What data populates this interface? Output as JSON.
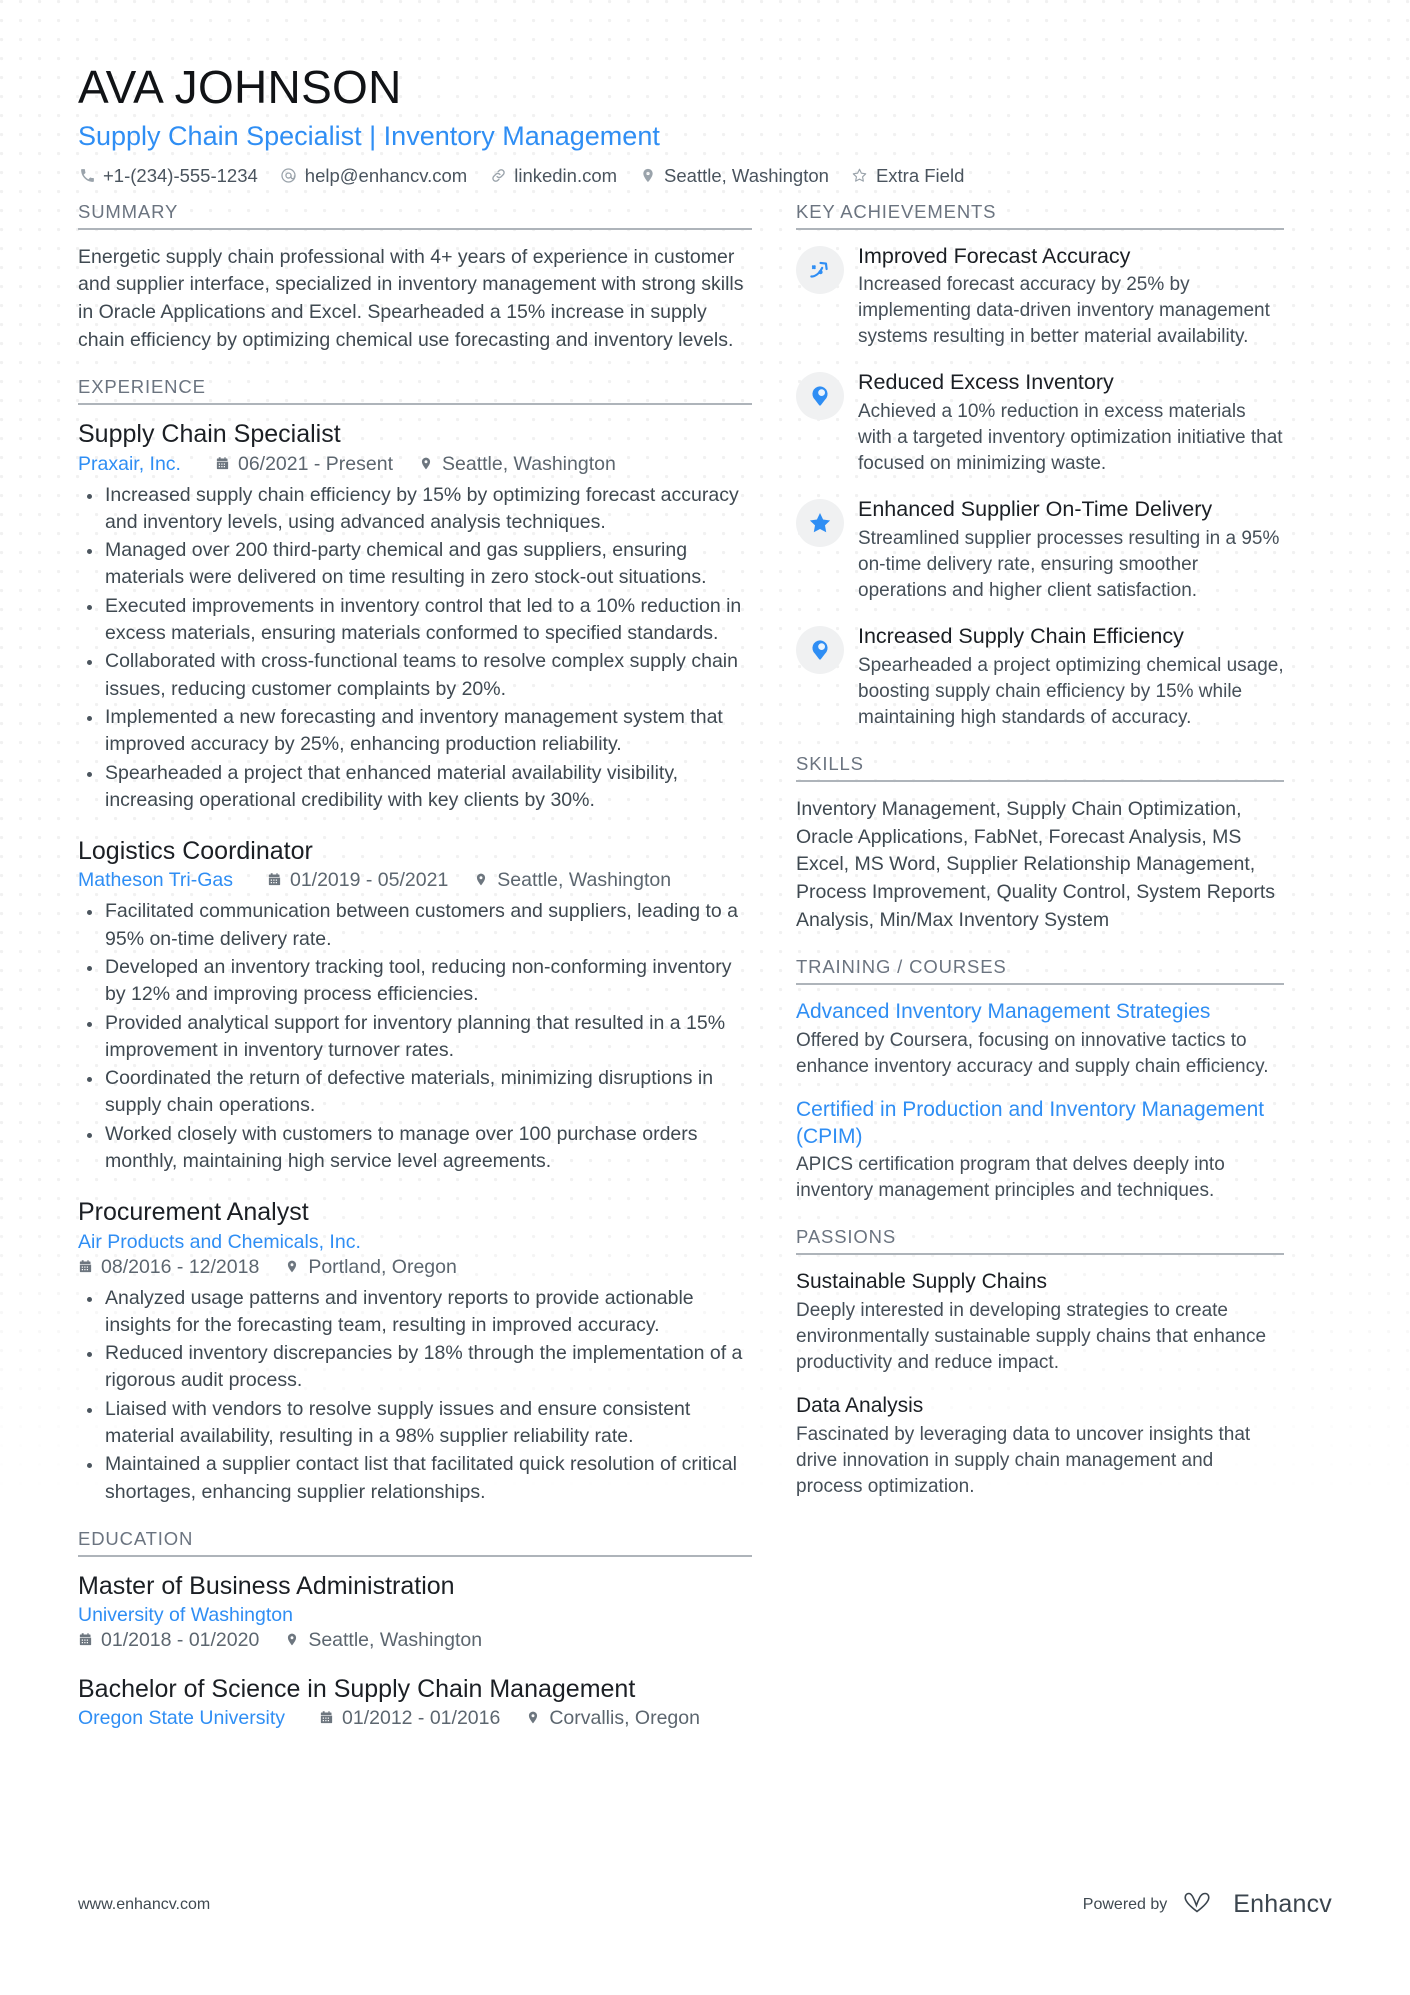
{
  "header": {
    "name": "AVA JOHNSON",
    "headline": "Supply Chain Specialist | Inventory Management",
    "contacts": [
      {
        "icon": "phone-icon",
        "text": "+1-(234)-555-1234"
      },
      {
        "icon": "email-icon",
        "text": "help@enhancv.com"
      },
      {
        "icon": "link-icon",
        "text": "linkedin.com"
      },
      {
        "icon": "location-icon",
        "text": "Seattle, Washington"
      },
      {
        "icon": "star-icon",
        "text": "Extra Field"
      }
    ]
  },
  "summary": {
    "section_title": "SUMMARY",
    "text": "Energetic supply chain professional with 4+ years of experience in customer and supplier interface, specialized in inventory management with strong skills in Oracle Applications and Excel. Spearheaded a 15% increase in supply chain efficiency by optimizing chemical use forecasting and inventory levels."
  },
  "experience": {
    "section_title": "EXPERIENCE",
    "entries": [
      {
        "title": "Supply Chain Specialist",
        "org": "Praxair, Inc.",
        "dates": "06/2021 - Present",
        "location": "Seattle, Washington",
        "bullets": [
          "Increased supply chain efficiency by 15% by optimizing forecast accuracy and inventory levels, using advanced analysis techniques.",
          "Managed over 200 third-party chemical and gas suppliers, ensuring materials were delivered on time resulting in zero stock-out situations.",
          "Executed improvements in inventory control that led to a 10% reduction in excess materials, ensuring materials conformed to specified standards.",
          "Collaborated with cross-functional teams to resolve complex supply chain issues, reducing customer complaints by 20%.",
          "Implemented a new forecasting and inventory management system that improved accuracy by 25%, enhancing production reliability.",
          "Spearheaded a project that enhanced material availability visibility, increasing operational credibility with key clients by 30%."
        ]
      },
      {
        "title": "Logistics Coordinator",
        "org": "Matheson Tri-Gas",
        "dates": "01/2019 - 05/2021",
        "location": "Seattle, Washington",
        "bullets": [
          "Facilitated communication between customers and suppliers, leading to a 95% on-time delivery rate.",
          "Developed an inventory tracking tool, reducing non-conforming inventory by 12% and improving process efficiencies.",
          "Provided analytical support for inventory planning that resulted in a 15% improvement in inventory turnover rates.",
          "Coordinated the return of defective materials, minimizing disruptions in supply chain operations.",
          "Worked closely with customers to manage over 100 purchase orders monthly, maintaining high service level agreements."
        ]
      },
      {
        "title": "Procurement Analyst",
        "org": "Air Products and Chemicals, Inc.",
        "dates": "08/2016 - 12/2018",
        "location": "Portland, Oregon",
        "org_on_own_line": true,
        "bullets": [
          "Analyzed usage patterns and inventory reports to provide actionable insights for the forecasting team, resulting in improved accuracy.",
          "Reduced inventory discrepancies by 18% through the implementation of a rigorous audit process.",
          "Liaised with vendors to resolve supply issues and ensure consistent material availability, resulting in a 98% supplier reliability rate.",
          "Maintained a supplier contact list that facilitated quick resolution of critical shortages, enhancing supplier relationships."
        ]
      }
    ]
  },
  "education": {
    "section_title": "EDUCATION",
    "entries": [
      {
        "title": "Master of Business Administration",
        "org": "University of Washington",
        "dates": "01/2018 - 01/2020",
        "location": "Seattle, Washington",
        "org_on_own_line": true
      },
      {
        "title": "Bachelor of Science in Supply Chain Management",
        "org": "Oregon State University",
        "dates": "01/2012 - 01/2016",
        "location": "Corvallis, Oregon",
        "org_on_own_line": false
      }
    ]
  },
  "key_achievements": {
    "section_title": "KEY ACHIEVEMENTS",
    "items": [
      {
        "icon": "trending-up-icon",
        "title": "Improved Forecast Accuracy",
        "desc": "Increased forecast accuracy by 25% by implementing data-driven inventory management systems resulting in better material availability."
      },
      {
        "icon": "pin-icon",
        "title": "Reduced Excess Inventory",
        "desc": "Achieved a 10% reduction in excess materials with a targeted inventory optimization initiative that focused on minimizing waste."
      },
      {
        "icon": "star-filled-icon",
        "title": "Enhanced Supplier On-Time Delivery",
        "desc": "Streamlined supplier processes resulting in a 95% on-time delivery rate, ensuring smoother operations and higher client satisfaction."
      },
      {
        "icon": "pin-icon",
        "title": "Increased Supply Chain Efficiency",
        "desc": "Spearheaded a project optimizing chemical usage, boosting supply chain efficiency by 15% while maintaining high standards of accuracy."
      }
    ]
  },
  "skills": {
    "section_title": "SKILLS",
    "text": "Inventory Management, Supply Chain Optimization, Oracle Applications, FabNet, Forecast Analysis, MS Excel, MS Word, Supplier Relationship Management, Process Improvement, Quality Control, System Reports Analysis, Min/Max Inventory System"
  },
  "training": {
    "section_title": "TRAINING / COURSES",
    "items": [
      {
        "title": "Advanced Inventory Management Strategies",
        "desc": "Offered by Coursera, focusing on innovative tactics to enhance inventory accuracy and supply chain efficiency."
      },
      {
        "title": "Certified in Production and Inventory Management (CPIM)",
        "desc": "APICS certification program that delves deeply into inventory management principles and techniques."
      }
    ]
  },
  "passions": {
    "section_title": "PASSIONS",
    "items": [
      {
        "title": "Sustainable Supply Chains",
        "desc": "Deeply interested in developing strategies to create environmentally sustainable supply chains that enhance productivity and reduce impact."
      },
      {
        "title": "Data Analysis",
        "desc": "Fascinated by leveraging data to uncover insights that drive innovation in supply chain management and process optimization."
      }
    ]
  },
  "footer": {
    "url": "www.enhancv.com",
    "powered_by": "Powered by",
    "brand": "Enhancv"
  },
  "colors": {
    "accent": "#2f8ef4",
    "text": "#3f4951",
    "muted": "#6b7480",
    "rule": "#aeb4ba",
    "icon_bg": "#f0f1f2"
  }
}
